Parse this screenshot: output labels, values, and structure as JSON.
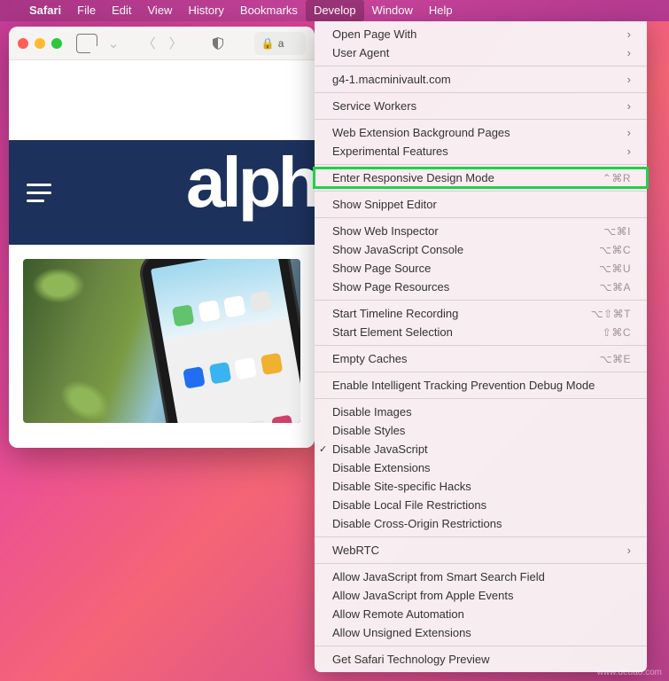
{
  "menubar": {
    "apple": "",
    "items": [
      {
        "label": "Safari",
        "app": true
      },
      {
        "label": "File"
      },
      {
        "label": "Edit"
      },
      {
        "label": "View"
      },
      {
        "label": "History"
      },
      {
        "label": "Bookmarks"
      },
      {
        "label": "Develop",
        "active": true
      },
      {
        "label": "Window"
      },
      {
        "label": "Help"
      }
    ]
  },
  "safari": {
    "address_prefix": "a",
    "lock": "🔒",
    "logo_visible": "alph"
  },
  "menu": {
    "groups": [
      [
        {
          "label": "Open Page With",
          "submenu": true
        },
        {
          "label": "User Agent",
          "submenu": true
        }
      ],
      [
        {
          "label": "g4-1.macminivault.com",
          "submenu": true
        }
      ],
      [
        {
          "label": "Service Workers",
          "submenu": true
        }
      ],
      [
        {
          "label": "Web Extension Background Pages",
          "submenu": true
        },
        {
          "label": "Experimental Features",
          "submenu": true
        }
      ],
      [
        {
          "label": "Enter Responsive Design Mode",
          "shortcut": "⌃⌘R",
          "highlighted": true
        }
      ],
      [
        {
          "label": "Show Snippet Editor"
        }
      ],
      [
        {
          "label": "Show Web Inspector",
          "shortcut": "⌥⌘I"
        },
        {
          "label": "Show JavaScript Console",
          "shortcut": "⌥⌘C"
        },
        {
          "label": "Show Page Source",
          "shortcut": "⌥⌘U"
        },
        {
          "label": "Show Page Resources",
          "shortcut": "⌥⌘A"
        }
      ],
      [
        {
          "label": "Start Timeline Recording",
          "shortcut": "⌥⇧⌘T"
        },
        {
          "label": "Start Element Selection",
          "shortcut": "⇧⌘C"
        }
      ],
      [
        {
          "label": "Empty Caches",
          "shortcut": "⌥⌘E"
        }
      ],
      [
        {
          "label": "Enable Intelligent Tracking Prevention Debug Mode"
        }
      ],
      [
        {
          "label": "Disable Images"
        },
        {
          "label": "Disable Styles"
        },
        {
          "label": "Disable JavaScript",
          "checked": true
        },
        {
          "label": "Disable Extensions"
        },
        {
          "label": "Disable Site-specific Hacks"
        },
        {
          "label": "Disable Local File Restrictions"
        },
        {
          "label": "Disable Cross-Origin Restrictions"
        }
      ],
      [
        {
          "label": "WebRTC",
          "submenu": true
        }
      ],
      [
        {
          "label": "Allow JavaScript from Smart Search Field"
        },
        {
          "label": "Allow JavaScript from Apple Events"
        },
        {
          "label": "Allow Remote Automation"
        },
        {
          "label": "Allow Unsigned Extensions"
        }
      ],
      [
        {
          "label": "Get Safari Technology Preview"
        }
      ]
    ]
  },
  "watermark": "www.deuao.com"
}
